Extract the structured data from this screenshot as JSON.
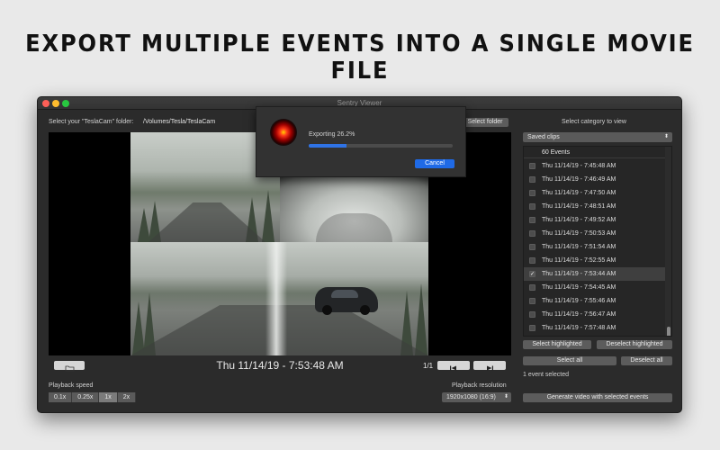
{
  "headline": "EXPORT MULTIPLE EVENTS INTO A SINGLE MOVIE FILE",
  "window": {
    "title": "Sentry Viewer"
  },
  "folder": {
    "prompt": "Select your \"TeslaCam\" folder:",
    "path": "/Volumes/Tesla/TeslaCam",
    "button": "Select folder"
  },
  "player": {
    "timestamp": "Thu 11/14/19 - 7:53:48 AM",
    "page": "1/1",
    "open_icon": "folder-icon",
    "prev_icon": "skip-previous-icon",
    "next_icon": "skip-next-icon"
  },
  "playback_speed": {
    "label": "Playback speed",
    "options": [
      "0.1x",
      "0.25x",
      "1x",
      "2x"
    ],
    "selected": "1x"
  },
  "playback_resolution": {
    "label": "Playback resolution",
    "value": "1920x1080 (16:9)"
  },
  "export_dialog": {
    "status": "Exporting 26.2%",
    "progress_percent": 26.2,
    "cancel": "Cancel"
  },
  "sidebar": {
    "category_label": "Select category to view",
    "category_value": "Saved clips",
    "list_header": "60 Events",
    "events": [
      {
        "label": "Thu 11/14/19 - 7:45:48 AM",
        "checked": false
      },
      {
        "label": "Thu 11/14/19 - 7:46:49 AM",
        "checked": false
      },
      {
        "label": "Thu 11/14/19 - 7:47:50 AM",
        "checked": false
      },
      {
        "label": "Thu 11/14/19 - 7:48:51 AM",
        "checked": false
      },
      {
        "label": "Thu 11/14/19 - 7:49:52 AM",
        "checked": false
      },
      {
        "label": "Thu 11/14/19 - 7:50:53 AM",
        "checked": false
      },
      {
        "label": "Thu 11/14/19 - 7:51:54 AM",
        "checked": false
      },
      {
        "label": "Thu 11/14/19 - 7:52:55 AM",
        "checked": false
      },
      {
        "label": "Thu 11/14/19 - 7:53:44 AM",
        "checked": true
      },
      {
        "label": "Thu 11/14/19 - 7:54:45 AM",
        "checked": false
      },
      {
        "label": "Thu 11/14/19 - 7:55:46 AM",
        "checked": false
      },
      {
        "label": "Thu 11/14/19 - 7:56:47 AM",
        "checked": false
      },
      {
        "label": "Thu 11/14/19 - 7:57:48 AM",
        "checked": false
      }
    ],
    "selected_index": 8,
    "select_highlighted": "Select highlighted",
    "deselect_highlighted": "Deselect highlighted",
    "select_all": "Select all",
    "deselect_all": "Deselect all",
    "selection_status": "1 event selected",
    "generate": "Generate video with selected events"
  }
}
